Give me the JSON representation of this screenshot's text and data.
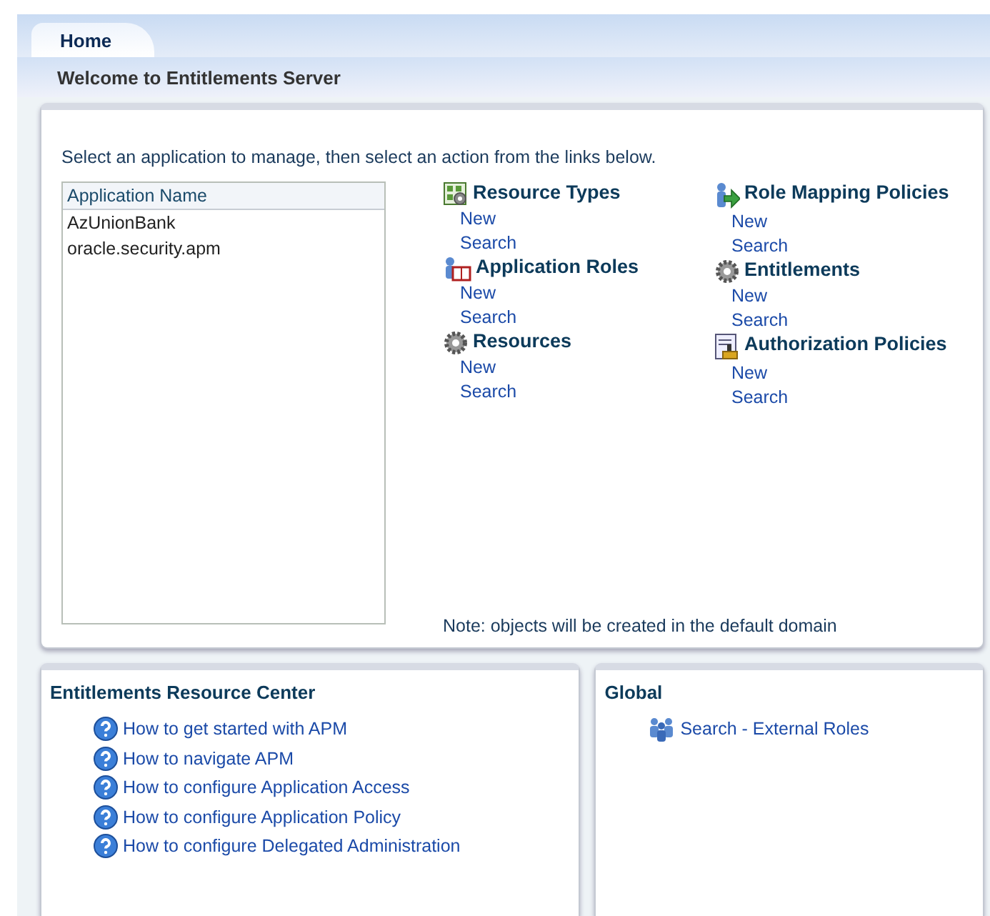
{
  "tabs": [
    {
      "label": "Home",
      "selected": true
    }
  ],
  "header": {
    "title": "Welcome to Entitlements Server"
  },
  "main": {
    "instruction": "Select an application to manage, then select an action from the links below.",
    "app_list": {
      "column": "Application Name",
      "rows": [
        {
          "name": "AzUnionBank",
          "selected": false
        },
        {
          "name": "oracle.security.apm",
          "selected": false
        }
      ]
    },
    "columns": [
      [
        {
          "title": "Resource Types",
          "kind": "grid",
          "links": [
            "New",
            "Search"
          ]
        },
        {
          "title": "Application Roles",
          "kind": "book",
          "links": [
            "New",
            "Search"
          ]
        },
        {
          "title": "Resources",
          "kind": "gear",
          "links": [
            "New",
            "Search"
          ]
        }
      ],
      [
        {
          "title": "Role Mapping Policies",
          "kind": "mapping",
          "links": [
            "New",
            "Search"
          ]
        },
        {
          "title": "Entitlements",
          "kind": "gears",
          "links": [
            "New",
            "Search"
          ]
        },
        {
          "title": "Authorization Policies",
          "kind": "stamp",
          "links": [
            "New",
            "Search"
          ]
        }
      ]
    ],
    "note": "Note: objects will be created in the default domain"
  },
  "resource_center": {
    "title": "Entitlements Resource Center",
    "links": [
      "How to get started with APM",
      "How to navigate APM",
      "How to configure Application Access",
      "How to configure Application Policy",
      "How to configure Delegated Administration"
    ]
  },
  "global": {
    "title": "Global",
    "links": [
      "Search - External Roles"
    ]
  }
}
